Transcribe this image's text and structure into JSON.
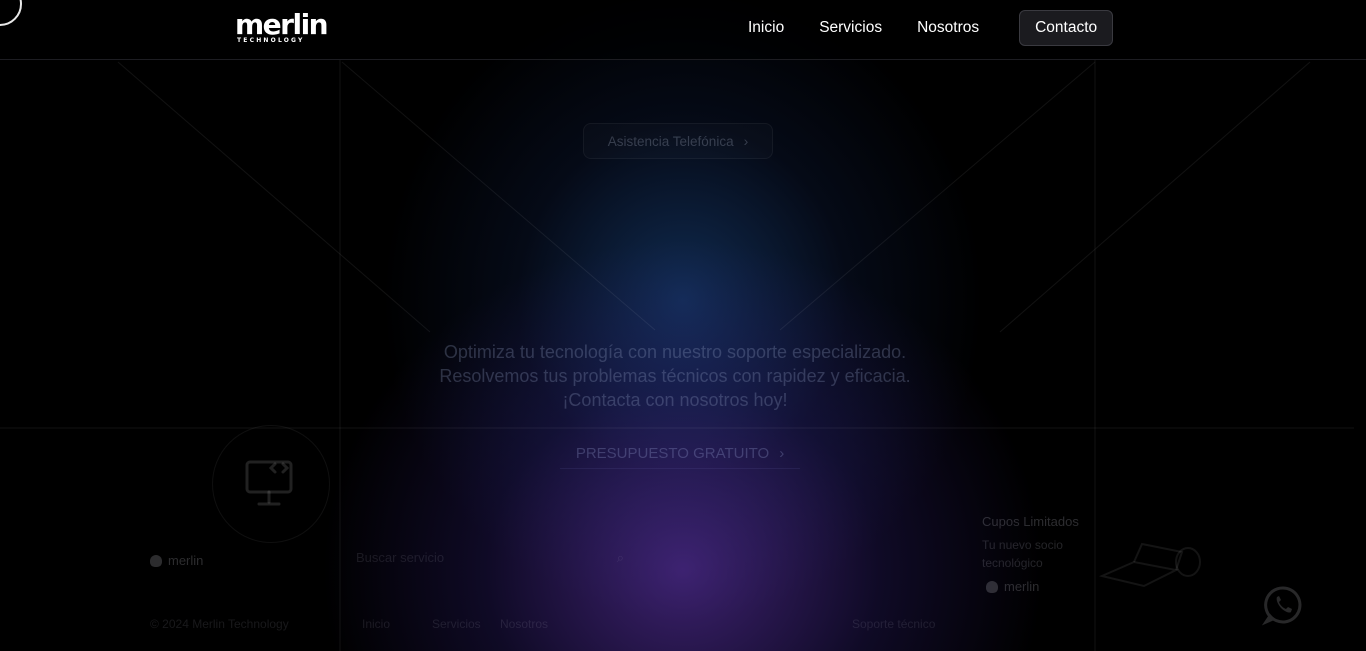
{
  "brand": {
    "logo_word": "merlin",
    "logo_sub": "TECHNOLOGY"
  },
  "nav": {
    "items": [
      "Inicio",
      "Servicios",
      "Nosotros"
    ],
    "contact": "Contacto"
  },
  "hero": {
    "pill_label": "Asistencia Telefónica",
    "text": "Optimiza tu tecnología con nuestro soporte especializado. Resolvemos tus problemas técnicos con rapidez y eficacia. ¡Contacta con nosotros hoy!",
    "cta_label": "PRESUPUESTO GRATUITO"
  },
  "cards": {
    "brand_left": "merlin",
    "search_placeholder": "Buscar servicio",
    "promo_title": "Cupos Limitados",
    "promo_sub": "Tu nuevo socio tecnológico",
    "brand_right": "merlin"
  },
  "footer": {
    "left": "© 2024 Merlin Technology",
    "links": [
      "Inicio",
      "Servicios",
      "Nosotros"
    ],
    "right": "Soporte técnico"
  },
  "icons": {
    "chevron": "chevron-right-icon",
    "whatsapp": "whatsapp-icon",
    "monitor": "monitor-code-icon"
  },
  "colors": {
    "accent_purple": "#6e3cc8",
    "accent_blue": "#1e5096",
    "nav_button_bg": "#1b1b1f"
  }
}
